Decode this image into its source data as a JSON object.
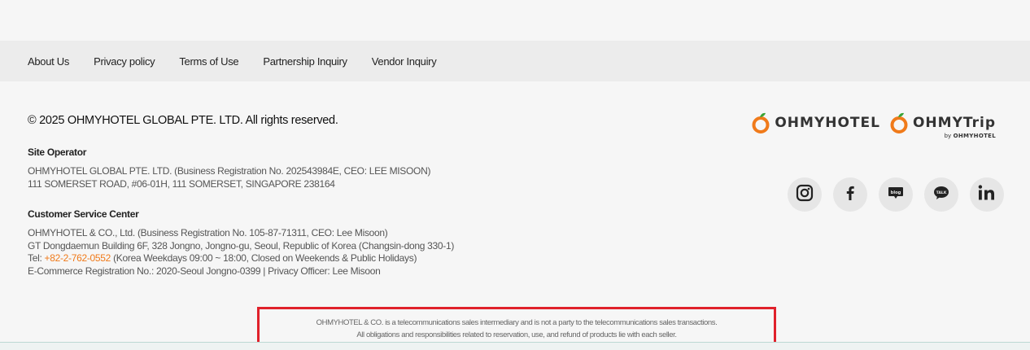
{
  "nav": {
    "links": [
      "About Us",
      "Privacy policy",
      "Terms of Use",
      "Partnership Inquiry",
      "Vendor Inquiry"
    ]
  },
  "copyright": "© 2025 OHMYHOTEL GLOBAL PTE. LTD. All rights reserved.",
  "site_operator": {
    "title": "Site Operator",
    "line1": "OHMYHOTEL GLOBAL PTE. LTD. (Business Registration No. 202543984E, CEO: LEE MISOON)",
    "line2": "111 SOMERSET ROAD, #06-01H, 111 SOMERSET, SINGAPORE 238164"
  },
  "customer_service": {
    "title": "Customer Service Center",
    "line1": "OHMYHOTEL & CO., Ltd. (Business Registration No. 105-87-71311, CEO: Lee Misoon)",
    "line2": "GT Dongdaemun Building 6F, 328 Jongno, Jongno-gu, Seoul, Republic of Korea (Changsin-dong 330-1)",
    "tel_label": "Tel: ",
    "tel_number": "+82-2-762-0552",
    "tel_hours": " (Korea Weekdays 09:00 ~ 18:00, Closed on Weekends & Public Holidays)",
    "line4": "E-Commerce Registration No.: 2020-Seoul Jongno-0399 | Privacy Officer: Lee Misoon"
  },
  "logos": {
    "hotel": "OHMYHOTEL",
    "trip": "OHMYTrip",
    "byline_prefix": "by ",
    "byline_brand": "OHMYHOTEL",
    "accent": "#f07a1a",
    "leaf": "#3aa335"
  },
  "socials": [
    "instagram-icon",
    "facebook-icon",
    "blog-icon",
    "kakaotalk-icon",
    "linkedin-icon"
  ],
  "notice": {
    "line1": "OHMYHOTEL & CO. is a telecommunications sales intermediary and is not a party to the telecommunications sales transactions.",
    "line2": "All obligations and responsibilities related to reservation, use, and refund of products lie with each seller.",
    "border_color": "#e0212b"
  }
}
